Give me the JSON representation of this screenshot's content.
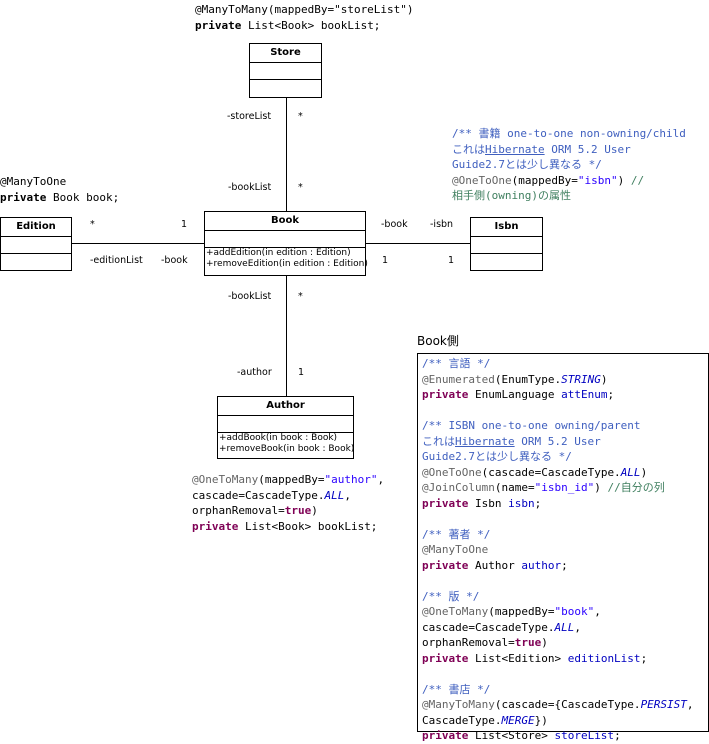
{
  "classes": {
    "store": {
      "name": "Store"
    },
    "book": {
      "name": "Book",
      "operations": [
        "+addEdition(in edition : Edition)",
        "+removeEdition(in edition : Edition)"
      ]
    },
    "edition": {
      "name": "Edition"
    },
    "isbn": {
      "name": "Isbn"
    },
    "author": {
      "name": "Author",
      "operations": [
        "+addBook(in book : Book)",
        "+removeBook(in book : Book)"
      ]
    }
  },
  "associations": {
    "store_book": {
      "store_role": "-storeList",
      "store_mult": "*",
      "book_role": "-bookList",
      "book_mult": "*"
    },
    "edition_book": {
      "edition_mult": "*",
      "book_mult": "1",
      "edition_role": "-editionList",
      "book_role": "-book"
    },
    "book_isbn": {
      "book_role": "-book",
      "isbn_role": "-isbn",
      "book_mult": "1",
      "isbn_mult": "1"
    },
    "book_author": {
      "book_role": "-bookList",
      "book_mult": "*",
      "author_role": "-author",
      "author_mult": "1"
    }
  },
  "snippets": {
    "store": [
      [
        [
          "t",
          "@ManyToMany(mappedBy=\"storeList\")"
        ]
      ],
      [
        [
          "kb",
          "private"
        ],
        [
          "t",
          " List<Book> bookList;"
        ]
      ]
    ],
    "edition": [
      [
        [
          "t",
          "@ManyToOne"
        ]
      ],
      [
        [
          "kb",
          "private"
        ],
        [
          "t",
          " Book book;"
        ]
      ]
    ],
    "isbn": [
      [
        [
          "c",
          "/** 書籍 one-to-one non-owning/child"
        ]
      ],
      [
        [
          "c",
          "これは"
        ],
        [
          "u",
          "Hibernate"
        ],
        [
          "c",
          " ORM 5.2 User"
        ]
      ],
      [
        [
          "c",
          "Guide2.7とは少し異なる */"
        ]
      ],
      [
        [
          "a",
          "@OneToOne"
        ],
        [
          "t",
          "(mappedBy="
        ],
        [
          "s",
          "\"isbn\""
        ],
        [
          "t",
          ") "
        ],
        [
          "g",
          "//"
        ]
      ],
      [
        [
          "g",
          "相手側(owning)の属性"
        ]
      ]
    ],
    "author": [
      [
        [
          "a",
          "@OneToMany"
        ],
        [
          "t",
          "(mappedBy="
        ],
        [
          "s",
          "\"author\""
        ],
        [
          "t",
          ","
        ]
      ],
      [
        [
          "t",
          "cascade=CascadeType."
        ],
        [
          "i",
          "ALL"
        ],
        [
          "t",
          ","
        ]
      ],
      [
        [
          "t",
          "orphanRemoval="
        ],
        [
          "k",
          "true"
        ],
        [
          "t",
          ")"
        ]
      ],
      [
        [
          "k",
          "private"
        ],
        [
          "t",
          " List<Book> bookList;"
        ]
      ]
    ]
  },
  "book_side": {
    "title": "Book側",
    "lines": [
      [
        [
          "c",
          "/** 言語 */"
        ]
      ],
      [
        [
          "a",
          "@Enumerated"
        ],
        [
          "t",
          "(EnumType."
        ],
        [
          "i",
          "STRING"
        ],
        [
          "t",
          ")"
        ]
      ],
      [
        [
          "k",
          "private"
        ],
        [
          "t",
          " EnumLanguage "
        ],
        [
          "f",
          "attEnum"
        ],
        [
          "t",
          ";"
        ]
      ],
      [],
      [
        [
          "c",
          "/** ISBN one-to-one owning/parent"
        ]
      ],
      [
        [
          "c",
          "これは"
        ],
        [
          "u",
          "Hibernate"
        ],
        [
          "c",
          " ORM 5.2 User"
        ]
      ],
      [
        [
          "c",
          "Guide2.7とは少し異なる */"
        ]
      ],
      [
        [
          "a",
          "@OneToOne"
        ],
        [
          "t",
          "(cascade=CascadeType."
        ],
        [
          "i",
          "ALL"
        ],
        [
          "t",
          ")"
        ]
      ],
      [
        [
          "a",
          "@JoinColumn"
        ],
        [
          "t",
          "(name="
        ],
        [
          "s",
          "\"isbn_id\""
        ],
        [
          "t",
          ") "
        ],
        [
          "g",
          "//自分の列"
        ]
      ],
      [
        [
          "k",
          "private"
        ],
        [
          "t",
          " Isbn "
        ],
        [
          "f",
          "isbn"
        ],
        [
          "t",
          ";"
        ]
      ],
      [],
      [
        [
          "c",
          "/** 著者 */"
        ]
      ],
      [
        [
          "a",
          "@ManyToOne"
        ]
      ],
      [
        [
          "k",
          "private"
        ],
        [
          "t",
          " Author "
        ],
        [
          "f",
          "author"
        ],
        [
          "t",
          ";"
        ]
      ],
      [],
      [
        [
          "c",
          "/** 版 */"
        ]
      ],
      [
        [
          "a",
          "@OneToMany"
        ],
        [
          "t",
          "(mappedBy="
        ],
        [
          "s",
          "\"book\""
        ],
        [
          "t",
          ","
        ]
      ],
      [
        [
          "t",
          "cascade=CascadeType."
        ],
        [
          "i",
          "ALL"
        ],
        [
          "t",
          ","
        ]
      ],
      [
        [
          "t",
          "orphanRemoval="
        ],
        [
          "k",
          "true"
        ],
        [
          "t",
          ")"
        ]
      ],
      [
        [
          "k",
          "private"
        ],
        [
          "t",
          " List<Edition> "
        ],
        [
          "f",
          "editionList"
        ],
        [
          "t",
          ";"
        ]
      ],
      [],
      [
        [
          "c",
          "/** 書店 */"
        ]
      ],
      [
        [
          "a",
          "@ManyToMany"
        ],
        [
          "t",
          "(cascade={CascadeType."
        ],
        [
          "i",
          "PERSIST"
        ],
        [
          "t",
          ","
        ]
      ],
      [
        [
          "t",
          "CascadeType."
        ],
        [
          "i",
          "MERGE"
        ],
        [
          "t",
          "})"
        ]
      ],
      [
        [
          "k",
          "private"
        ],
        [
          "t",
          " List<Store> "
        ],
        [
          "f",
          "storeList"
        ],
        [
          "t",
          ";"
        ]
      ]
    ]
  }
}
